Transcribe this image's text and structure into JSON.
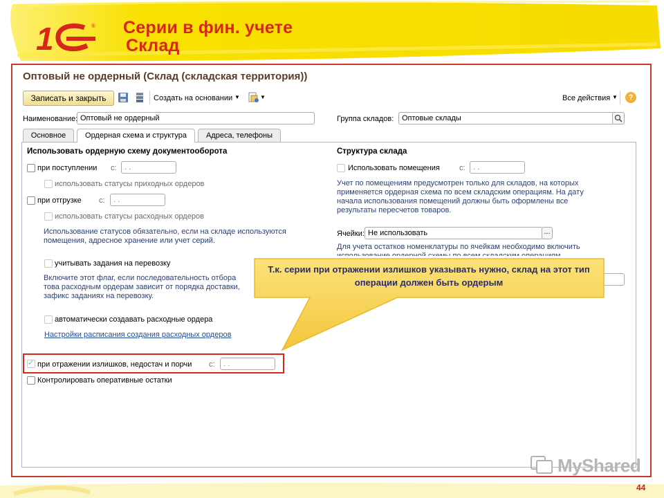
{
  "slide": {
    "title_line1": "Серии в фин. учете",
    "title_line2": "Склад",
    "page_number": "44",
    "watermark": "MyShared"
  },
  "form": {
    "title": "Оптовый не ордерный (Склад (складская территория))",
    "toolbar": {
      "save_close": "Записать и закрыть",
      "create_based": "Создать на основании",
      "all_actions": "Все действия",
      "help": "?"
    },
    "name_label": "Наименование:",
    "name_value": "Оптовый не ордерный",
    "group_label": "Группа складов:",
    "group_value": "Оптовые склады",
    "tabs": [
      {
        "label": "Основное"
      },
      {
        "label": "Ордерная схема и структура"
      },
      {
        "label": "Адреса, телефоны"
      }
    ],
    "left": {
      "heading": "Использовать ордерную схему документооборота",
      "receipt_label": "при поступлении",
      "receipt_from": "с:",
      "receipt_date": ". .",
      "receipt_status": "использовать статусы приходных ордеров",
      "shipment_label": "при отгрузке",
      "shipment_from": "с:",
      "shipment_date": ". .",
      "shipment_status": "использовать статусы расходных ордеров",
      "statuses_note": "Использование статусов обязательно, если на складе используются помещения, адресное хранение или учет серий.",
      "transfer_tasks": "учитывать задания на перевозку",
      "transfer_note": "Включите этот флаг, если последовательность отбора това расходным ордерам зависит от порядка доставки, зафикс заданиях на перевозку.",
      "auto_orders": "автоматически создавать расходные ордера",
      "schedule_link": "Настройки расписания создания расходных ордеров",
      "surplus_label": "при отражении излишков, недостач и порчи",
      "surplus_from": "с:",
      "surplus_date": ". .",
      "control_balances": "Контролировать оперативные остатки"
    },
    "right": {
      "heading": "Структура склада",
      "use_rooms": "Использовать помещения",
      "rooms_from": "с:",
      "rooms_date": ". .",
      "rooms_note": "Учет по помещениям предусмотрен только для складов, на которых применяется ордерная схема по всем складским операциям. На дату начала использования помещений должны быть оформлены все результаты пересчетов товаров.",
      "cells_label": "Ячейки:",
      "cells_value": "Не использовать",
      "cells_note": "Для учета остатков номенклатуры по ячейкам необходимо включить использование ордерной схемы по всем складским операциям."
    }
  },
  "callout": {
    "text": "Т.к. серии при отражении излишков указывать нужно, склад на этот тип операции должен быть ордерым"
  },
  "colors": {
    "title_red": "#d6271b",
    "highlight_yellow": "#f7e500",
    "callout_yellow": "#f8d85a",
    "frame_red": "#c9392a"
  }
}
